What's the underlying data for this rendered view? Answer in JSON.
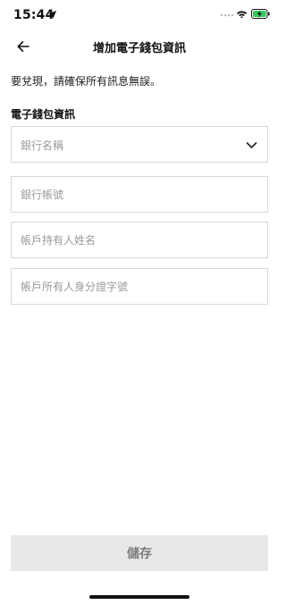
{
  "status_bar": {
    "time": "15:44",
    "icons": [
      "location-arrow-icon",
      "cellular-signal-icon",
      "wifi-icon",
      "battery-charging-icon"
    ],
    "battery_color": "#34c759"
  },
  "nav": {
    "back_icon": "arrow-left-icon",
    "title": "增加電子錢包資訊"
  },
  "notice": "要兌現，請確保所有訊息無誤。",
  "form": {
    "section_title": "電子錢包資訊",
    "bank_name_placeholder": "銀行名稱",
    "bank_account_placeholder": "銀行帳號",
    "holder_name_placeholder": "帳戶持有人姓名",
    "holder_id_placeholder": "帳戶所有人身分證字號"
  },
  "save_label": "儲存",
  "colors": {
    "button_bg": "#e8e8e8",
    "button_text": "#7b7b7b",
    "border": "#d9d9d9",
    "placeholder": "#9a9a9a"
  }
}
